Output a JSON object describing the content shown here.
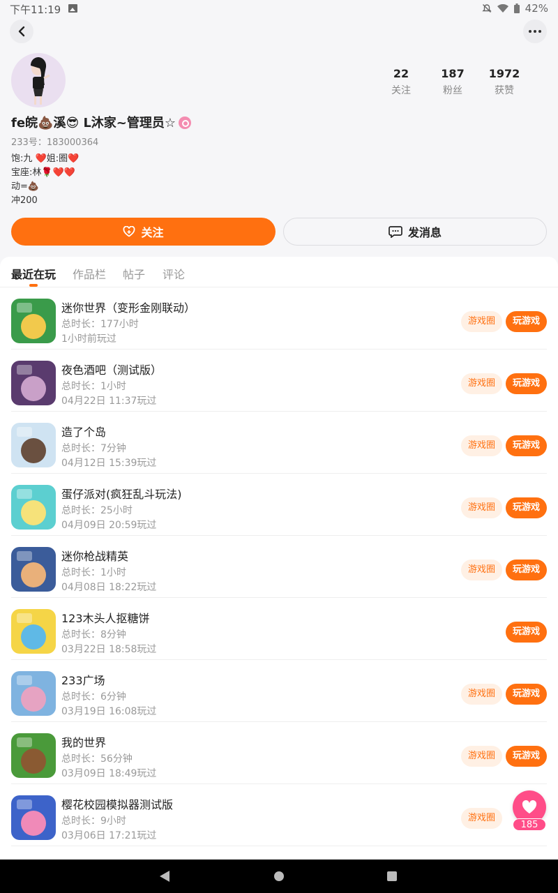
{
  "status_bar": {
    "time": "下午11:19",
    "battery": "42%"
  },
  "profile": {
    "stats": [
      {
        "num": "22",
        "label": "关注"
      },
      {
        "num": "187",
        "label": "粉丝"
      },
      {
        "num": "1972",
        "label": "获赞"
      }
    ],
    "nickname": "fe皖💩溪😎 ᒪ沐家~管理员☆",
    "user_id": "233号：183000364",
    "bio": [
      "饱:九 ❤️姐:圈❤️",
      "宝座:林🌹❤️❤️",
      "动=💩",
      "冲200"
    ]
  },
  "actions": {
    "follow_label": "关注",
    "message_label": "发消息"
  },
  "tabs": [
    "最近在玩",
    "作品栏",
    "帖子",
    "评论"
  ],
  "games": [
    {
      "title": "迷你世界（变形金刚联动）",
      "time": "总时长：177小时",
      "last": "1小时前玩过",
      "circle": "游戏圈",
      "play": "玩游戏",
      "c1": "#3a9b4a",
      "c2": "#f2c94c"
    },
    {
      "title": "夜色酒吧（测试版）",
      "time": "总时长：1小时",
      "last": "04月22日 11:37玩过",
      "circle": "游戏圈",
      "play": "玩游戏",
      "c1": "#5a3b6e",
      "c2": "#c9a0c8"
    },
    {
      "title": "造了个岛",
      "time": "总时长：7分钟",
      "last": "04月12日 15:39玩过",
      "circle": "游戏圈",
      "play": "玩游戏",
      "c1": "#cfe3f2",
      "c2": "#6a5040"
    },
    {
      "title": "蛋仔派对(疯狂乱斗玩法)",
      "time": "总时长：25小时",
      "last": "04月09日 20:59玩过",
      "circle": "游戏圈",
      "play": "玩游戏",
      "c1": "#5ccfd0",
      "c2": "#f6e27a"
    },
    {
      "title": "迷你枪战精英",
      "time": "总时长：1小时",
      "last": "04月08日 18:22玩过",
      "circle": "游戏圈",
      "play": "玩游戏",
      "c1": "#3b5c9a",
      "c2": "#e9b07a"
    },
    {
      "title": "123木头人抠糖饼",
      "time": "总时长：8分钟",
      "last": "03月22日 18:58玩过",
      "circle": "",
      "play": "玩游戏",
      "c1": "#f5d547",
      "c2": "#5fb9e6"
    },
    {
      "title": "233广场",
      "time": "总时长：6分钟",
      "last": "03月19日 16:08玩过",
      "circle": "游戏圈",
      "play": "玩游戏",
      "c1": "#7fb3e0",
      "c2": "#e6a3c2"
    },
    {
      "title": "我的世界",
      "time": "总时长：56分钟",
      "last": "03月09日 18:49玩过",
      "circle": "游戏圈",
      "play": "玩游戏",
      "c1": "#4a9a3a",
      "c2": "#8a5a32"
    },
    {
      "title": "樱花校园模拟器测试版",
      "time": "总时长：9小时",
      "last": "03月06日 17:21玩过",
      "circle": "游戏圈",
      "play": "",
      "c1": "#3d63c9",
      "c2": "#f08ab8"
    }
  ],
  "float_like": {
    "count": "185"
  }
}
